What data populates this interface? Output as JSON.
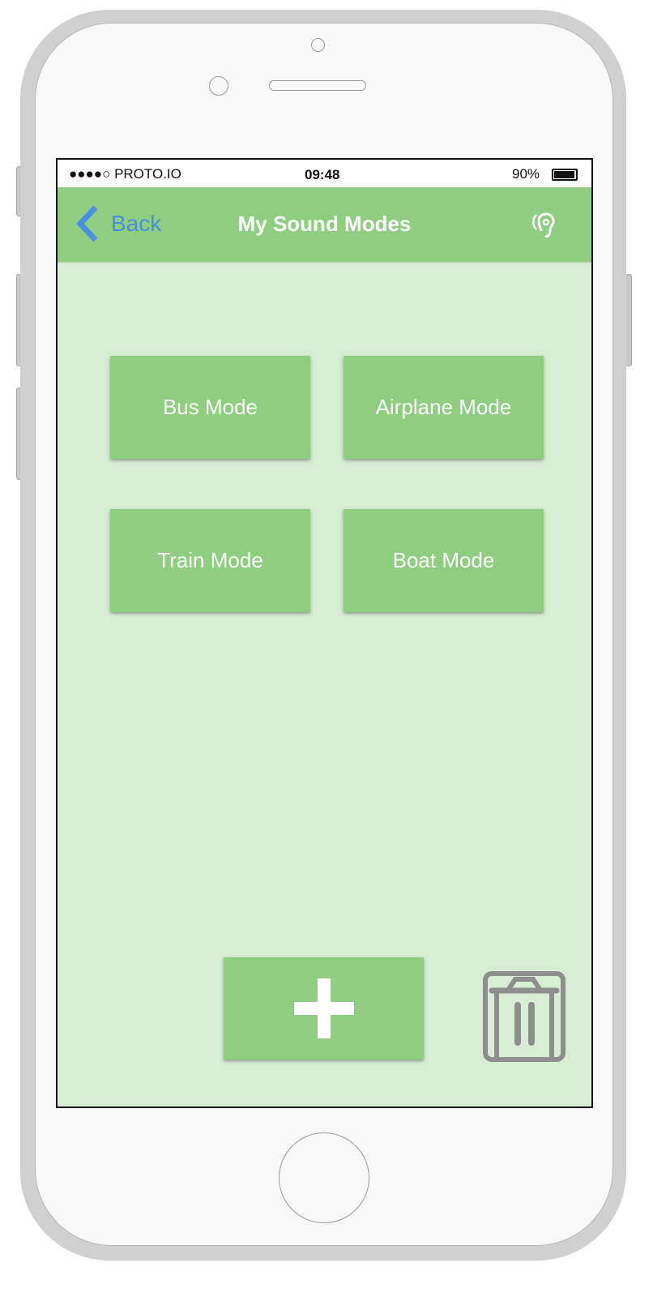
{
  "status_bar": {
    "carrier": "●●●●○ PROTO.IO",
    "time": "09:48",
    "battery": "90%",
    "battery_level": 0.9
  },
  "nav": {
    "back_label": "Back",
    "title": "My Sound Modes",
    "right_icon": "ear-icon"
  },
  "modes": [
    {
      "label": "Bus Mode"
    },
    {
      "label": "Airplane Mode"
    },
    {
      "label": "Train Mode"
    },
    {
      "label": "Boat Mode"
    }
  ],
  "actions": {
    "add_icon": "plus-icon",
    "delete_icon": "trash-icon"
  },
  "colors": {
    "nav": "#8fcd80",
    "background": "#d8eed4",
    "link": "#4a90e2",
    "icon_gray": "#8e8e8e"
  }
}
